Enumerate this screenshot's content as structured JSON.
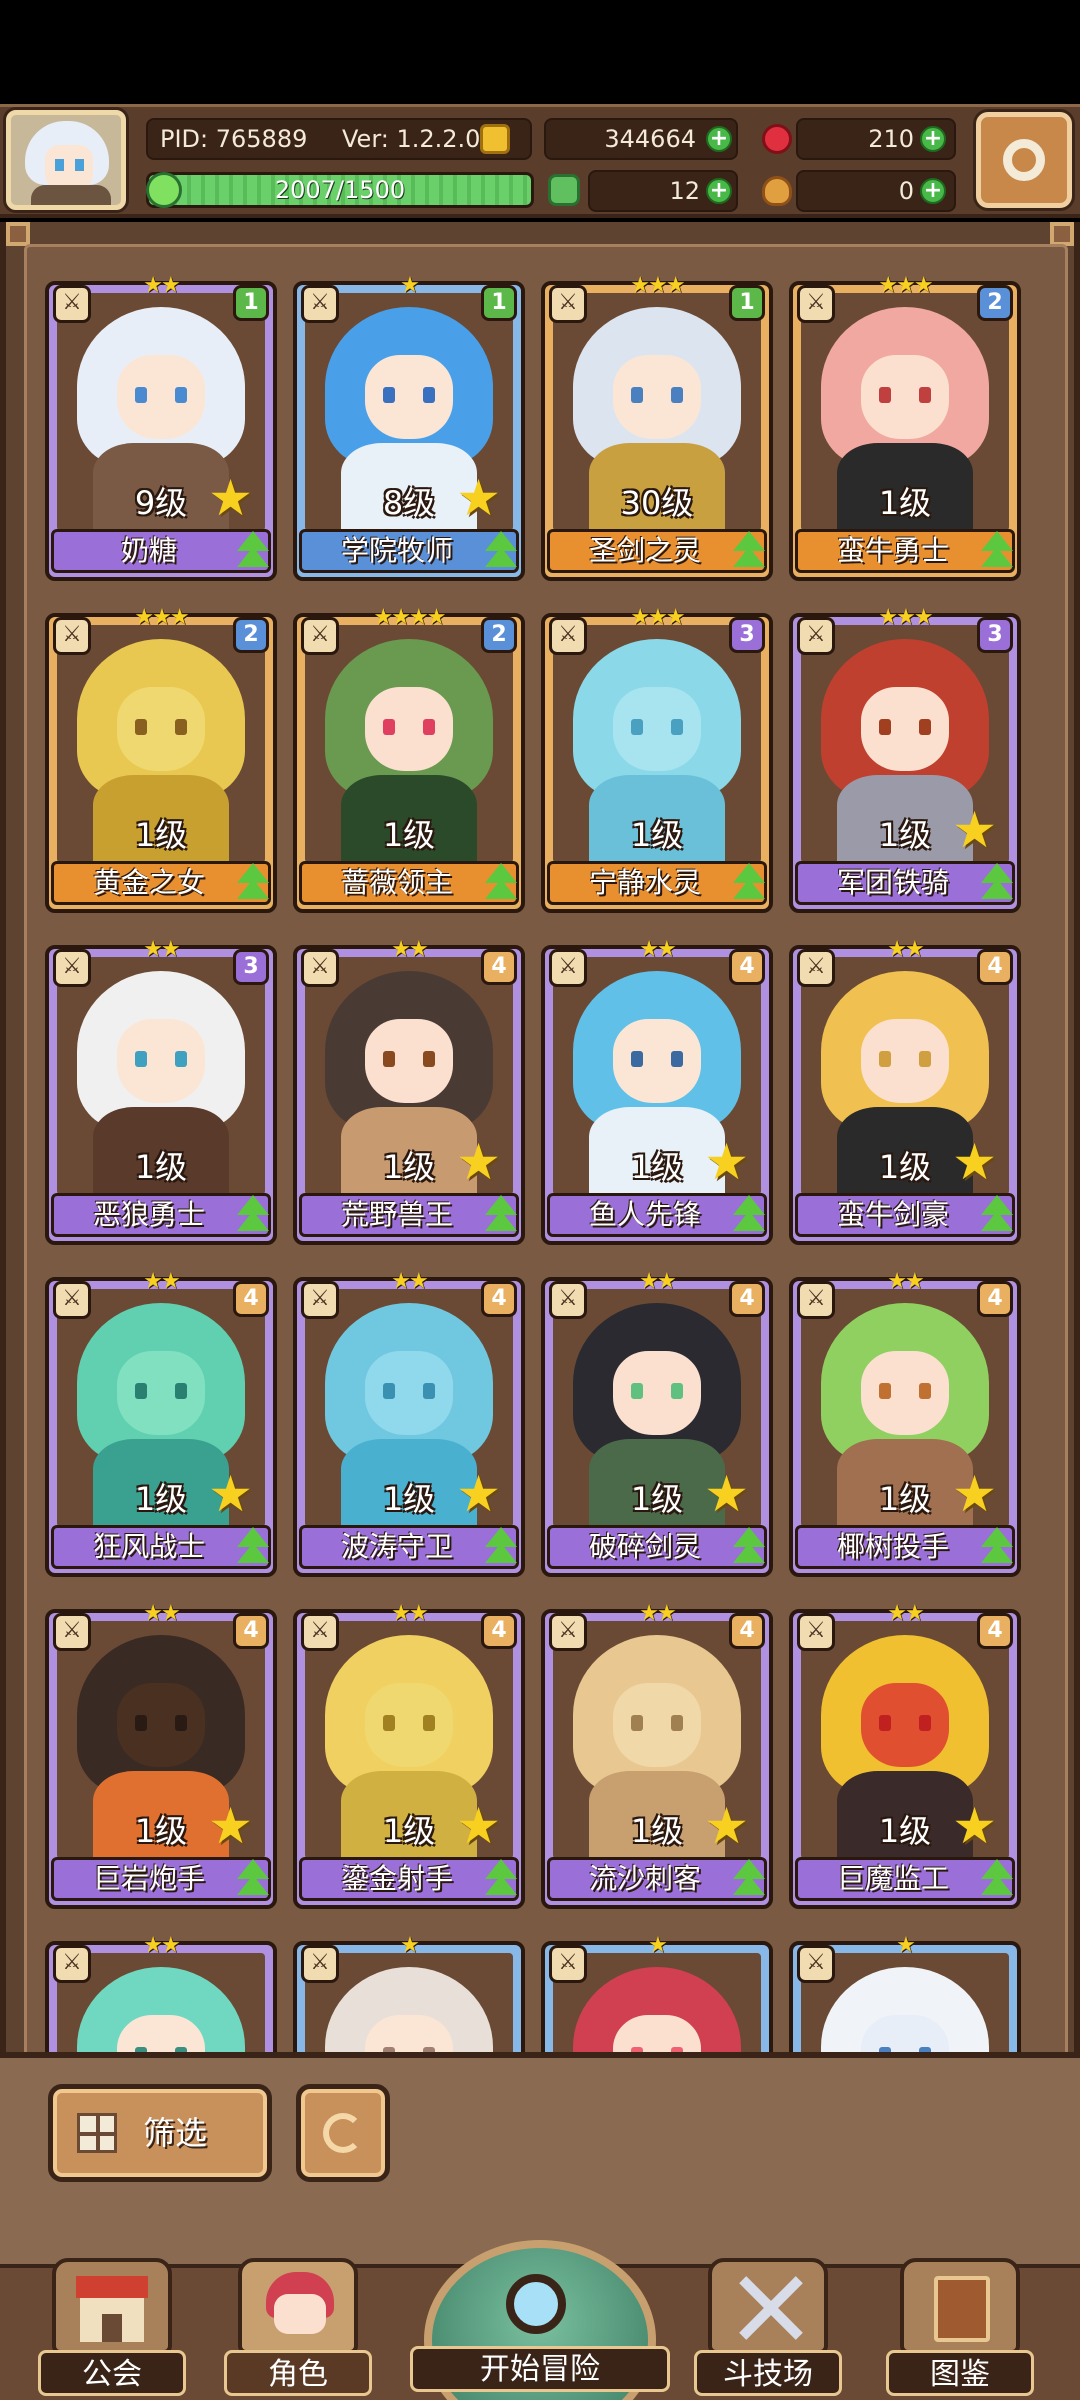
{
  "header": {
    "pid": "PID: 765889",
    "version": "Ver: 1.2.2.0",
    "gold": "344664",
    "gems": "210",
    "exp": "2007/1500",
    "clover": "12",
    "potion": "0"
  },
  "cards": [
    {
      "name": "奶糖",
      "level": "9级",
      "stars": "★★",
      "tier": "1",
      "rarity": "purple",
      "upgradable": true,
      "colors": [
        "#e8eef8",
        "#fbe6d6",
        "#7a5a44",
        "#4a8ad0"
      ]
    },
    {
      "name": "学院牧师",
      "level": "8级",
      "stars": "★",
      "tier": "1",
      "rarity": "blue",
      "upgradable": true,
      "colors": [
        "#4aa0e8",
        "#fbe6d6",
        "#e8f0f8",
        "#3a70c0"
      ]
    },
    {
      "name": "圣剑之灵",
      "level": "30级",
      "stars": "★★★",
      "tier": "1",
      "rarity": "orange",
      "upgradable": false,
      "colors": [
        "#dce4f0",
        "#fbe6d6",
        "#c8a040",
        "#4a80c0"
      ]
    },
    {
      "name": "蛮牛勇士",
      "level": "1级",
      "stars": "★★★",
      "tier": "2",
      "rarity": "orange",
      "upgradable": false,
      "colors": [
        "#f0a8a0",
        "#fbe0d0",
        "#2a2a2a",
        "#c04040"
      ]
    },
    {
      "name": "黄金之女",
      "level": "1级",
      "stars": "★★★",
      "tier": "2",
      "rarity": "orange",
      "upgradable": false,
      "colors": [
        "#e8c850",
        "#f0d870",
        "#c8a030",
        "#8a6020"
      ]
    },
    {
      "name": "蔷薇领主",
      "level": "1级",
      "stars": "★★★★",
      "tier": "2",
      "rarity": "orange",
      "upgradable": false,
      "colors": [
        "#6a9a50",
        "#fbe0d0",
        "#2a4a2a",
        "#e04060"
      ]
    },
    {
      "name": "宁静水灵",
      "level": "1级",
      "stars": "★★★",
      "tier": "3",
      "rarity": "orange",
      "upgradable": false,
      "colors": [
        "#8ad8e8",
        "#a8e4f0",
        "#6ac0d8",
        "#4aa0c0"
      ]
    },
    {
      "name": "军团铁骑",
      "level": "1级",
      "stars": "★★★",
      "tier": "3",
      "rarity": "purple",
      "upgradable": true,
      "colors": [
        "#c04030",
        "#fbe0d0",
        "#9a9aa8",
        "#a04020"
      ]
    },
    {
      "name": "恶狼勇士",
      "level": "1级",
      "stars": "★★",
      "tier": "3",
      "rarity": "purple",
      "upgradable": false,
      "colors": [
        "#f0f0f0",
        "#fbe6d6",
        "#5a3a2a",
        "#40a0c0"
      ]
    },
    {
      "name": "荒野兽王",
      "level": "1级",
      "stars": "★★",
      "tier": "4",
      "rarity": "purple",
      "upgradable": true,
      "colors": [
        "#4a3a34",
        "#fbe0d0",
        "#c89a70",
        "#8a4a20"
      ]
    },
    {
      "name": "鱼人先锋",
      "level": "1级",
      "stars": "★★",
      "tier": "4",
      "rarity": "purple",
      "upgradable": true,
      "colors": [
        "#60c0e8",
        "#fbe6d6",
        "#e8f0f8",
        "#3a6aa0"
      ]
    },
    {
      "name": "蛮牛剑豪",
      "level": "1级",
      "stars": "★★",
      "tier": "4",
      "rarity": "purple",
      "upgradable": true,
      "colors": [
        "#f0c050",
        "#fbe0d0",
        "#2a2a2a",
        "#d0a040"
      ]
    },
    {
      "name": "狂风战士",
      "level": "1级",
      "stars": "★★",
      "tier": "4",
      "rarity": "purple",
      "upgradable": true,
      "colors": [
        "#60d0b0",
        "#80e0c0",
        "#3aa090",
        "#2a8070"
      ]
    },
    {
      "name": "波涛守卫",
      "level": "1级",
      "stars": "★★",
      "tier": "4",
      "rarity": "purple",
      "upgradable": true,
      "colors": [
        "#70c8e0",
        "#90d8ec",
        "#4ab0d0",
        "#3a90b0"
      ]
    },
    {
      "name": "破碎剑灵",
      "level": "1级",
      "stars": "★★",
      "tier": "4",
      "rarity": "purple",
      "upgradable": true,
      "colors": [
        "#2a2a30",
        "#fbe0d0",
        "#4a6a4a",
        "#60c080"
      ]
    },
    {
      "name": "椰树投手",
      "level": "1级",
      "stars": "★★",
      "tier": "4",
      "rarity": "purple",
      "upgradable": true,
      "colors": [
        "#90d060",
        "#fbe0d0",
        "#a07050",
        "#c07030"
      ]
    },
    {
      "name": "巨岩炮手",
      "level": "1级",
      "stars": "★★",
      "tier": "4",
      "rarity": "purple",
      "upgradable": true,
      "colors": [
        "#3a2a24",
        "#4a3020",
        "#e07030",
        "#2a1a14"
      ]
    },
    {
      "name": "鎏金射手",
      "level": "1级",
      "stars": "★★",
      "tier": "4",
      "rarity": "purple",
      "upgradable": true,
      "colors": [
        "#f0d060",
        "#f0d870",
        "#d0b040",
        "#a08020"
      ]
    },
    {
      "name": "流沙刺客",
      "level": "1级",
      "stars": "★★",
      "tier": "4",
      "rarity": "purple",
      "upgradable": true,
      "colors": [
        "#e8c890",
        "#f0d8a8",
        "#c8a070",
        "#a08050"
      ]
    },
    {
      "name": "巨魔监工",
      "level": "1级",
      "stars": "★★",
      "tier": "4",
      "rarity": "purple",
      "upgradable": true,
      "colors": [
        "#f0c030",
        "#e05030",
        "#3a2a2a",
        "#c02020"
      ]
    },
    {
      "name": "",
      "level": "",
      "stars": "★★",
      "tier": "",
      "rarity": "purple",
      "upgradable": false,
      "colors": [
        "#70d8c0",
        "#fbe6d6",
        "#4ab0a0",
        "#3a9080"
      ]
    },
    {
      "name": "",
      "level": "",
      "stars": "★",
      "tier": "",
      "rarity": "blue",
      "upgradable": false,
      "colors": [
        "#e8e0d8",
        "#fbe6d6",
        "#c8b8a8",
        "#a08070"
      ]
    },
    {
      "name": "",
      "level": "",
      "stars": "★",
      "tier": "",
      "rarity": "blue",
      "upgradable": false,
      "colors": [
        "#d04050",
        "#fbe0d0",
        "#a02030",
        "#f06070"
      ]
    },
    {
      "name": "",
      "level": "",
      "stars": "★",
      "tier": "",
      "rarity": "blue",
      "upgradable": false,
      "colors": [
        "#f0f4f8",
        "#e8eef8",
        "#d0d8e8",
        "#4a80c0"
      ]
    }
  ],
  "controls": {
    "filter_label": "筛选"
  },
  "nav": {
    "guild": "公会",
    "character": "角色",
    "adventure": "开始冒险",
    "arena": "斗技场",
    "codex": "图鉴"
  }
}
